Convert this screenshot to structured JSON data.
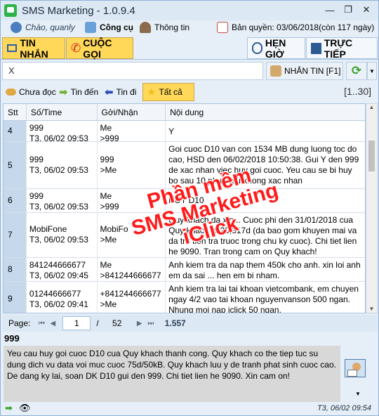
{
  "window": {
    "title": "SMS Marketing - 1.0.9.4",
    "controls": [
      "—",
      "❐",
      "✕"
    ]
  },
  "info": {
    "greeting": "Chào, quanly",
    "tools": "Công cụ",
    "profile": "Thông tin",
    "license": "Bản quyền: 03/06/2018(còn 117 ngày)"
  },
  "tabs": {
    "sms": "TIN NHẮN",
    "calls": "CUỘC GỌI",
    "schedule": "HẸN GIỜ",
    "live": "TRỰC TIẾP"
  },
  "input": {
    "value": "X",
    "send_label": "NHẮN TIN [F1]"
  },
  "filters": {
    "unread": "Chưa đọc",
    "incoming": "Tin đến",
    "outgoing": "Tin đi",
    "all": "Tất cả",
    "range": "[1..30]"
  },
  "table": {
    "headers": [
      "Stt",
      "Số/Time",
      "Gởi/Nhận",
      "Nội dung"
    ],
    "rows": [
      {
        "stt": "4",
        "num": "999",
        "time": "T3, 06/02 09:53",
        "gn1": "Me",
        "gn2": ">999",
        "content": "Y"
      },
      {
        "stt": "5",
        "num": "999",
        "time": "T3, 06/02 09:53",
        "gn1": "999",
        "gn2": ">Me",
        "content": "Goi cuoc D10 van con 1534 MB dung luong toc do cao, HSD den 06/02/2018 10:50:38. Gui Y den 999 de xac nhan viec huy goi cuoc. Yeu cau se bi huy bo sau 10 phut neu khong xac nhan"
      },
      {
        "stt": "6",
        "num": "999",
        "time": "T3, 06/02 09:53",
        "gn1": "Me",
        "gn2": ">999",
        "content": "HUY D10"
      },
      {
        "stt": "7",
        "num": "MobiFone",
        "time": "T3, 06/02 09:53",
        "gn1": "MobiFo",
        "gn2": ">Me",
        "content": "Quy khach da xin... Cuoc phi den 31/01/2018 cua Quy khach la 20,317d (da bao gom khuyen mai va da tru tien tra truoc trong chu ky cuoc). Chi tiet lien he 9090. Tran trong cam on Quy khach!"
      },
      {
        "stt": "8",
        "num": "841244666677",
        "time": "T3, 06/02 09:45",
        "gn1": "Me",
        "gn2": ">841244666677",
        "content": "Anh kiem tra da nap them 450k cho anh. xin loi anh em da sai ... hen em bi nham."
      },
      {
        "stt": "9",
        "num": "01244666677",
        "time": "T3, 06/02 09:41",
        "gn1": "+841244666677",
        "gn2": ">Me",
        "content": "Anh kiem tra lai tai khoan vietcombank, em chuyen ngay 4/2 vao tai khoan nguyenvanson 500 ngan. Nhung moi nap iclick 50 ngan."
      }
    ]
  },
  "pager": {
    "label": "Page:",
    "current": "1",
    "sep": "/",
    "total": "52",
    "count": "1.557"
  },
  "detail": {
    "sender": "999",
    "message": "Yeu cau huy goi cuoc D10 cua Quy khach thanh cong. Quy khach co the tiep tuc su dung dich vu data voi muc cuoc 75d/50kB. Quy khach luu y de tranh phat sinh cuoc cao. De dang ky lai, soan DK D10 gui den 999. Chi tiet lien he 9090. Xin cam on!",
    "timestamp": "T3, 06/02 09:54"
  },
  "watermark": {
    "line1": "Phần mềm",
    "line2": "SMS Marketing",
    "line3": "iClick"
  }
}
